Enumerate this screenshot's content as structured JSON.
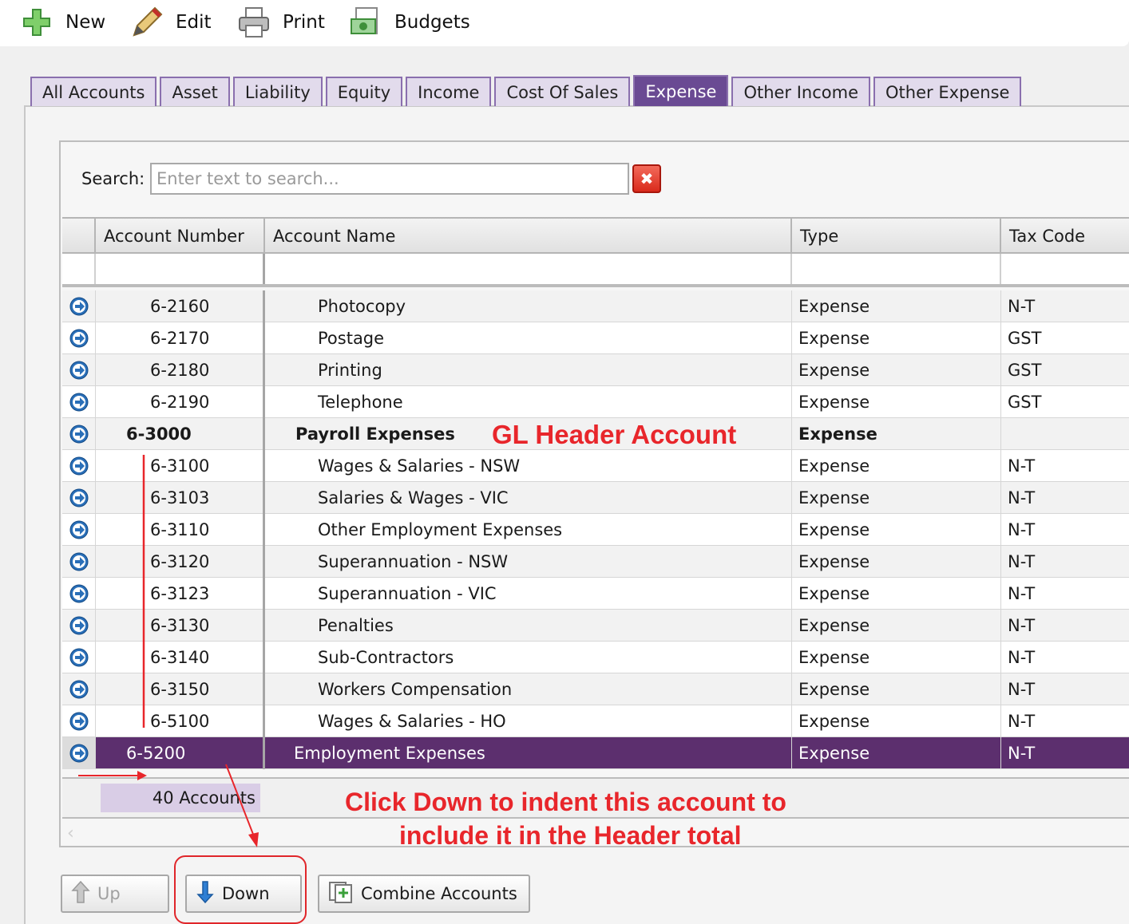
{
  "toolbar": {
    "new_label": "New",
    "edit_label": "Edit",
    "print_label": "Print",
    "budgets_label": "Budgets"
  },
  "tabs": [
    {
      "label": "All Accounts",
      "active": false
    },
    {
      "label": "Asset",
      "active": false
    },
    {
      "label": "Liability",
      "active": false
    },
    {
      "label": "Equity",
      "active": false
    },
    {
      "label": "Income",
      "active": false
    },
    {
      "label": "Cost Of Sales",
      "active": false
    },
    {
      "label": "Expense",
      "active": true
    },
    {
      "label": "Other Income",
      "active": false
    },
    {
      "label": "Other Expense",
      "active": false
    }
  ],
  "search": {
    "label": "Search:",
    "placeholder": "Enter text to search...",
    "value": ""
  },
  "columns": {
    "number": "Account Number",
    "name": "Account Name",
    "type": "Type",
    "tax": "Tax Code"
  },
  "rows": [
    {
      "number": "6-2160",
      "name": "Photocopy",
      "type": "Expense",
      "tax": "N-T",
      "level": 2
    },
    {
      "number": "6-2170",
      "name": "Postage",
      "type": "Expense",
      "tax": "GST",
      "level": 2
    },
    {
      "number": "6-2180",
      "name": "Printing",
      "type": "Expense",
      "tax": "GST",
      "level": 2
    },
    {
      "number": "6-2190",
      "name": "Telephone",
      "type": "Expense",
      "tax": "GST",
      "level": 2
    },
    {
      "number": "6-3000",
      "name": "Payroll Expenses",
      "type": "Expense",
      "tax": "",
      "level": 1,
      "header": true
    },
    {
      "number": "6-3100",
      "name": "Wages & Salaries - NSW",
      "type": "Expense",
      "tax": "N-T",
      "level": 2
    },
    {
      "number": "6-3103",
      "name": "Salaries & Wages - VIC",
      "type": "Expense",
      "tax": "N-T",
      "level": 2
    },
    {
      "number": "6-3110",
      "name": "Other Employment Expenses",
      "type": "Expense",
      "tax": "N-T",
      "level": 2
    },
    {
      "number": "6-3120",
      "name": "Superannuation - NSW",
      "type": "Expense",
      "tax": "N-T",
      "level": 2
    },
    {
      "number": "6-3123",
      "name": "Superannuation - VIC",
      "type": "Expense",
      "tax": "N-T",
      "level": 2
    },
    {
      "number": "6-3130",
      "name": "Penalties",
      "type": "Expense",
      "tax": "N-T",
      "level": 2
    },
    {
      "number": "6-3140",
      "name": "Sub-Contractors",
      "type": "Expense",
      "tax": "N-T",
      "level": 2
    },
    {
      "number": "6-3150",
      "name": "Workers Compensation",
      "type": "Expense",
      "tax": "N-T",
      "level": 2
    },
    {
      "number": "6-5100",
      "name": "Wages & Salaries - HO",
      "type": "Expense",
      "tax": "N-T",
      "level": 2
    },
    {
      "number": "6-5200",
      "name": "Employment Expenses",
      "type": "Expense",
      "tax": "N-T",
      "level": 1,
      "selected": true
    }
  ],
  "footer": {
    "count": "40 Accounts"
  },
  "buttons": {
    "up": "Up",
    "down": "Down",
    "combine": "Combine Accounts"
  },
  "annotations": {
    "header_note": "GL Header Account",
    "down_note_line1": "Click Down to indent this account to",
    "down_note_line2": "include it in the Header total"
  },
  "colors": {
    "accent": "#5c2f6e",
    "tab_active": "#6a4a93",
    "annotation": "#e8262b"
  }
}
